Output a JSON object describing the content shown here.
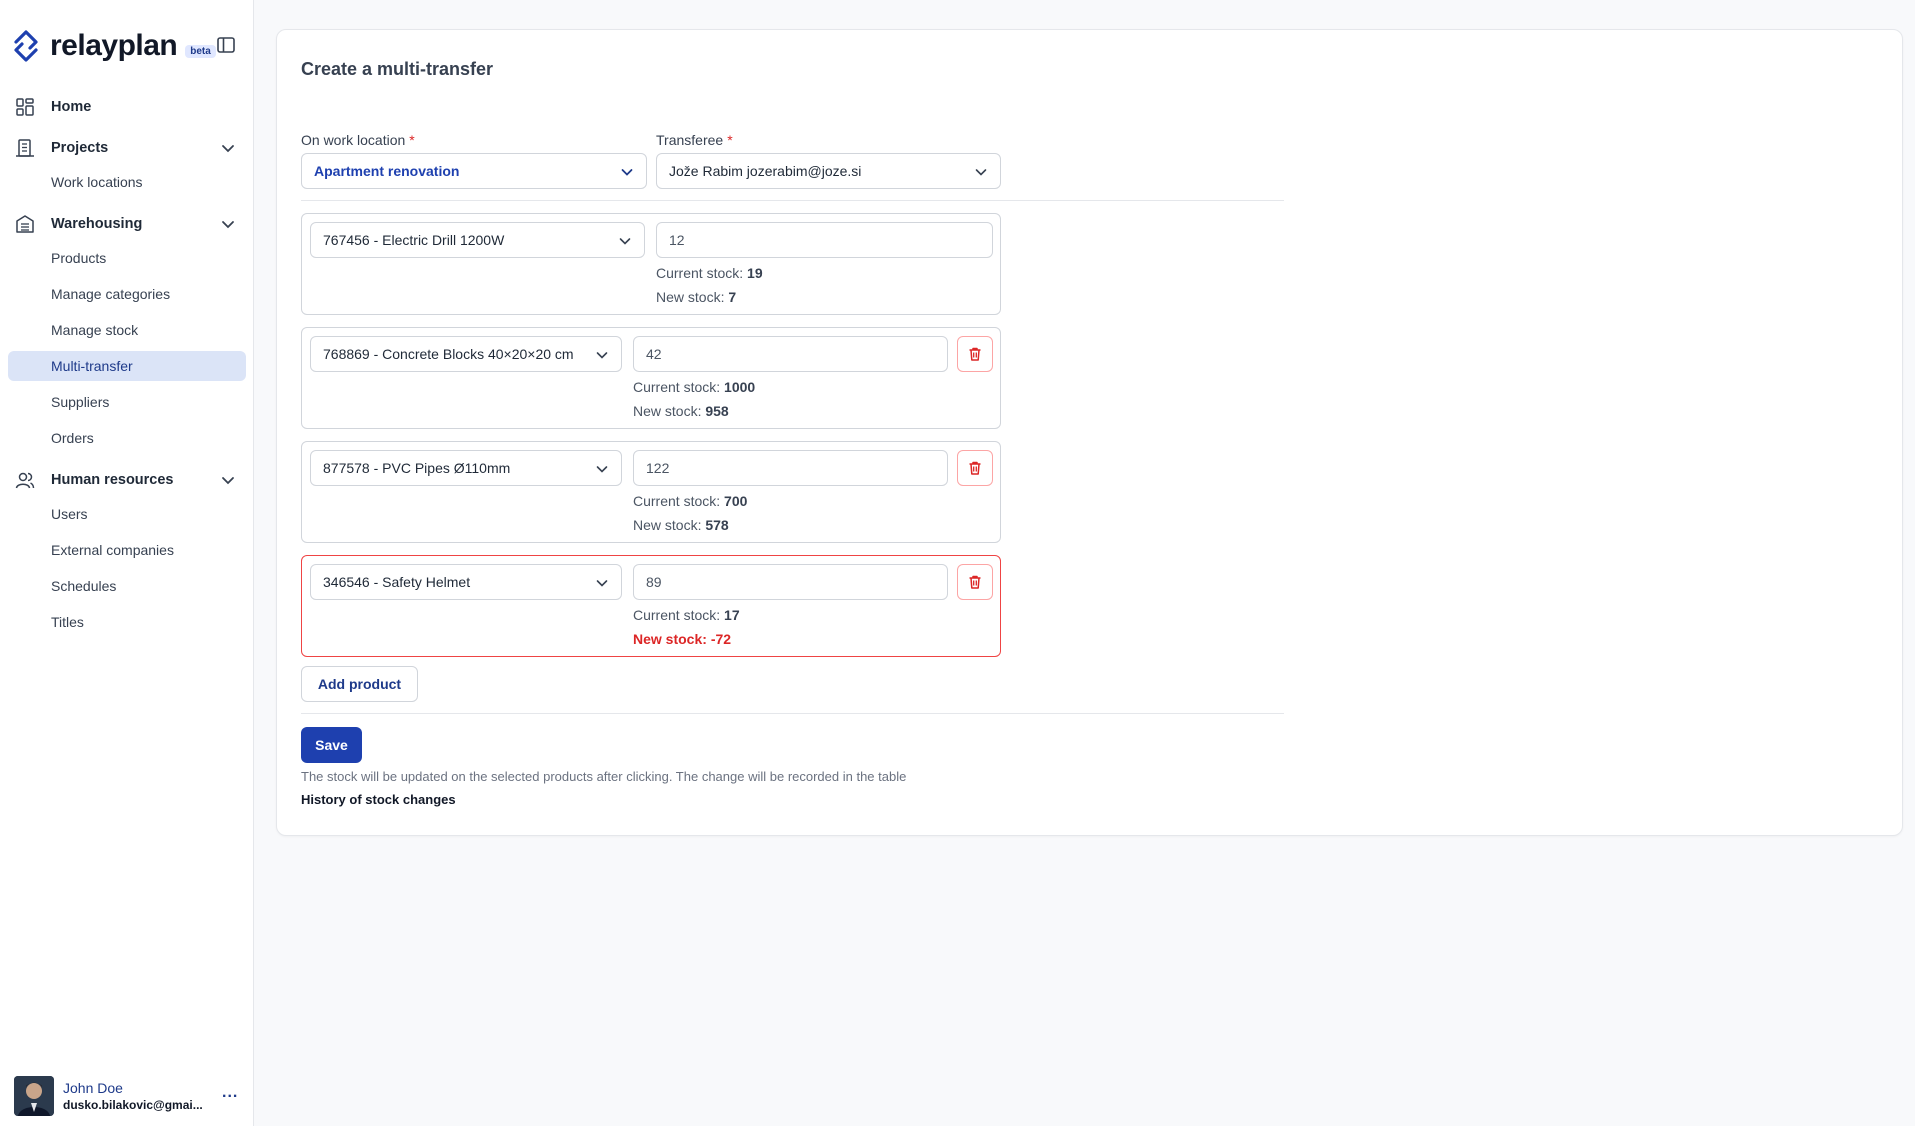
{
  "brand": {
    "name": "relayplan",
    "badge": "beta"
  },
  "sidebar": {
    "home": "Home",
    "projects": {
      "label": "Projects",
      "items": [
        "Work locations"
      ]
    },
    "warehousing": {
      "label": "Warehousing",
      "items": [
        "Products",
        "Manage categories",
        "Manage stock",
        "Multi-transfer",
        "Suppliers",
        "Orders"
      ],
      "active": "Multi-transfer"
    },
    "hr": {
      "label": "Human resources",
      "items": [
        "Users",
        "External companies",
        "Schedules",
        "Titles"
      ]
    },
    "user": {
      "name": "John Doe",
      "email": "dusko.bilakovic@gmai...",
      "more": "..."
    }
  },
  "form": {
    "title": "Create a multi-transfer",
    "work_location": {
      "label": "On work location",
      "required": "*",
      "value": "Apartment renovation"
    },
    "transferee": {
      "label": "Transferee",
      "required": "*",
      "value": "Jože Rabim jozerabim@joze.si"
    },
    "current_stock_label": "Current stock:",
    "new_stock_label": "New stock:",
    "rows": [
      {
        "product": "767456 - Electric Drill 1200W",
        "quantity": "12",
        "current_stock": "19",
        "new_stock": "7"
      },
      {
        "product": "768869 - Concrete Blocks 40×20×20 cm",
        "quantity": "42",
        "current_stock": "1000",
        "new_stock": "958"
      },
      {
        "product": "877578 - PVC Pipes Ø110mm",
        "quantity": "122",
        "current_stock": "700",
        "new_stock": "578"
      },
      {
        "product": "346546 - Safety Helmet",
        "quantity": "89",
        "current_stock": "17",
        "new_stock": "-72"
      }
    ],
    "add_product": "Add product",
    "save": "Save",
    "help_text": "The stock will be updated on the selected products after clicking. The change will be recorded in the table",
    "history_link": "History of stock changes"
  },
  "colors": {
    "accent": "#1e40af",
    "error": "#dc2626",
    "active_nav": "#dbe4f7"
  }
}
